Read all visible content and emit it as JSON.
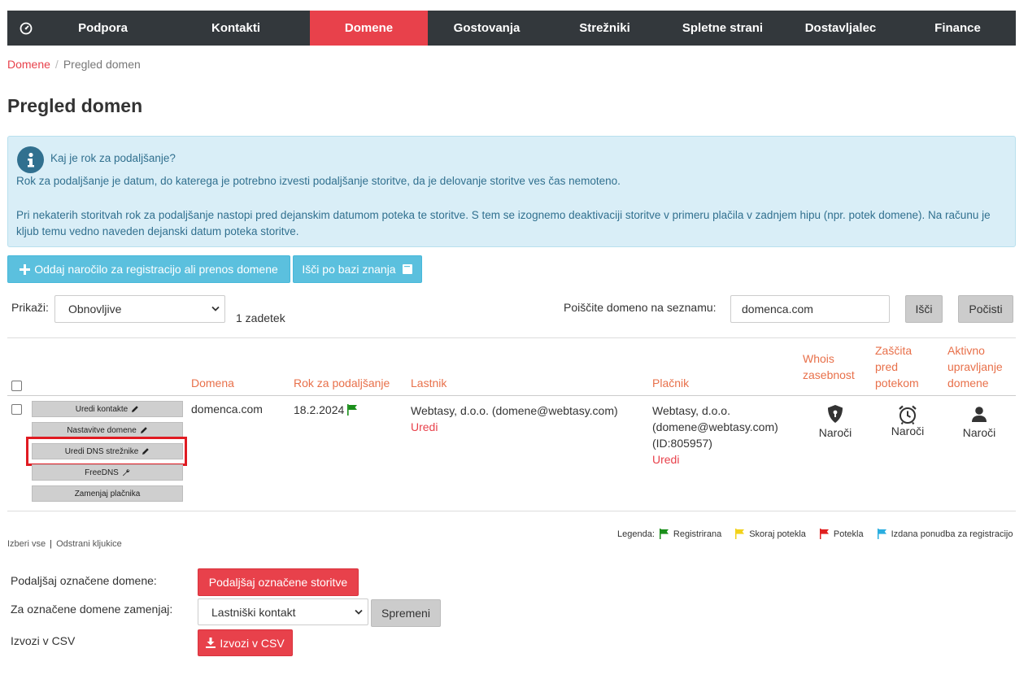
{
  "nav": {
    "items": [
      {
        "label": "Podpora"
      },
      {
        "label": "Kontakti"
      },
      {
        "label": "Domene"
      },
      {
        "label": "Gostovanja"
      },
      {
        "label": "Strežniki"
      },
      {
        "label": "Spletne strani"
      },
      {
        "label": "Dostavljalec"
      },
      {
        "label": "Finance"
      }
    ],
    "active": "Domene",
    "active_color": "#e8414b",
    "bg_color": "#33383c"
  },
  "breadcrumb": {
    "root": "Domene",
    "current": "Pregled domen"
  },
  "page_title": "Pregled domen",
  "info": {
    "icon": "info-icon",
    "heading": "Kaj je rok za podaljšanje?",
    "p1": "Rok za podaljšanje je datum, do katerega je potrebno izvesti podaljšanje storitve, da je delovanje storitve ves čas nemoteno.",
    "p2": "Pri nekaterih storitvah rok za podaljšanje nastopi pred dejanskim datumom poteka te storitve. S tem se izognemo deaktivaciji storitve v primeru plačila v zadnjem hipu (npr. potek domene). Na računu je kljub temu vedno naveden dejanski datum poteka storitve."
  },
  "actions": {
    "order_label": "Oddaj naročilo za registracijo ali prenos domene",
    "kb_label": "Išči po bazi znanja"
  },
  "filter": {
    "show_label": "Prikaži:",
    "show_value": "Obnovljive",
    "count": "1 zadetek",
    "search_label": "Poiščite domeno na seznamu:",
    "search_value": "domenca.com",
    "search_button": "Išči",
    "clear_button": "Počisti"
  },
  "table": {
    "headers": {
      "domain": "Domena",
      "renewal": "Rok za podaljšanje",
      "owner": "Lastnik",
      "payer": "Plačnik",
      "whois": [
        "Whois",
        "zasebnost"
      ],
      "expiry": [
        "Zaščita",
        "pred",
        "potekom"
      ],
      "active": [
        "Aktivno",
        "upravljanje",
        "domene"
      ]
    },
    "row": {
      "buttons": [
        "Uredi kontakte",
        "Nastavitve domene",
        "Uredi DNS strežnike",
        "FreeDNS",
        "Zamenjaj plačnika"
      ],
      "domain": "domenca.com",
      "renewal": "18.2.2024",
      "owner": "Webtasy, d.o.o. (domene@webtasy.com)",
      "owner_edit": "Uredi",
      "payer_lines": [
        "Webtasy, d.o.o.",
        "(domene@webtasy.com)",
        "(ID:805957)"
      ],
      "payer_edit": "Uredi",
      "order": "Naroči",
      "highlighted_button": "Uredi DNS strežnike"
    }
  },
  "footer": {
    "select_all": "Izberi vse",
    "separator": "|",
    "remove_marks": "Odstrani kljukice",
    "legend_label": "Legenda:",
    "legend": [
      {
        "label": "Registrirana",
        "color": "#1a8f1a"
      },
      {
        "label": "Skoraj potekla",
        "color": "#f2d21b"
      },
      {
        "label": "Potekla",
        "color": "#e02020"
      },
      {
        "label": "Izdana ponudba za registracijo",
        "color": "#2aaee0"
      }
    ]
  },
  "bulk": {
    "renew_label": "Podaljšaj označene domene:",
    "renew_button": "Podaljšaj označene storitve",
    "replace_label": "Za označene domene zamenjaj:",
    "replace_value": "Lastniški kontakt",
    "replace_button": "Spremeni",
    "csv_label": "Izvozi v CSV",
    "csv_button": "Izvozi v CSV"
  }
}
